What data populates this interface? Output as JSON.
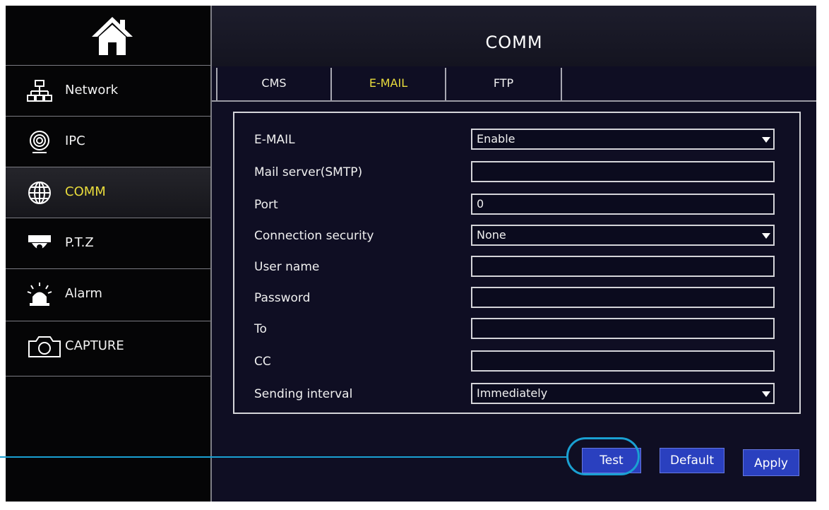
{
  "header": {
    "title": "COMM"
  },
  "sidebar": {
    "home_icon": "home-icon",
    "items": [
      {
        "label": "Network",
        "icon": "network-icon",
        "active": false
      },
      {
        "label": "IPC",
        "icon": "ipc-camera-icon",
        "active": false
      },
      {
        "label": "COMM",
        "icon": "globe-icon",
        "active": true
      },
      {
        "label": "P.T.Z",
        "icon": "dome-camera-icon",
        "active": false
      },
      {
        "label": "Alarm",
        "icon": "alarm-siren-icon",
        "active": false
      },
      {
        "label": "CAPTURE",
        "icon": "camera-icon",
        "active": false
      }
    ]
  },
  "tabs": [
    {
      "label": "CMS",
      "active": false
    },
    {
      "label": "E-MAIL",
      "active": true
    },
    {
      "label": "FTP",
      "active": false
    }
  ],
  "form": {
    "fields": [
      {
        "label": "E-MAIL",
        "value": "Enable",
        "type": "select"
      },
      {
        "label": "Mail server(SMTP)",
        "value": "",
        "type": "text"
      },
      {
        "label": "Port",
        "value": "0",
        "type": "text"
      },
      {
        "label": "Connection security",
        "value": "None",
        "type": "select"
      },
      {
        "label": "User name",
        "value": "",
        "type": "text"
      },
      {
        "label": "Password",
        "value": "",
        "type": "text"
      },
      {
        "label": "To",
        "value": "",
        "type": "text"
      },
      {
        "label": "CC",
        "value": "",
        "type": "text"
      },
      {
        "label": "Sending interval",
        "value": "Immediately",
        "type": "select"
      }
    ]
  },
  "buttons": {
    "test": "Test",
    "default": "Default",
    "apply": "Apply"
  },
  "colors": {
    "background": "#050506",
    "content_bg": "#0f0e23",
    "active_text": "#e9dc3c",
    "button_bg": "#2a40bf",
    "callout": "#1aa0d2"
  }
}
